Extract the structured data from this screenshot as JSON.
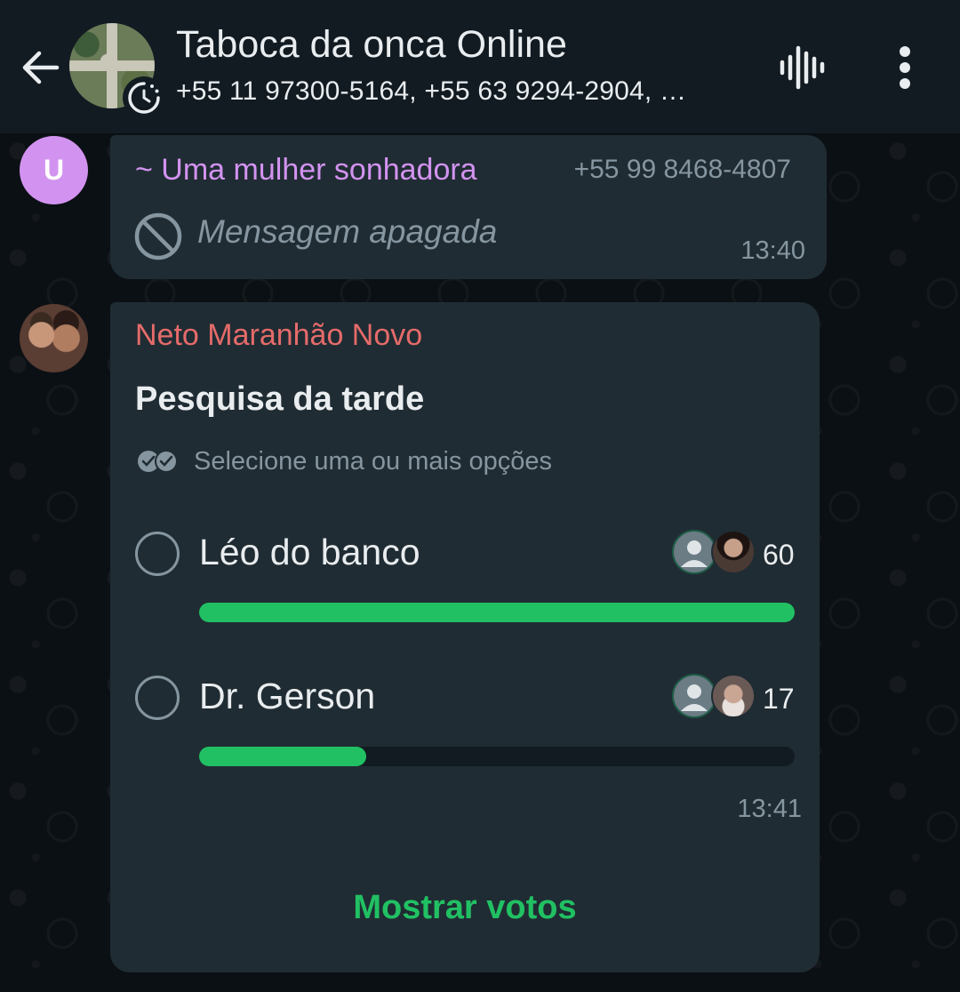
{
  "header": {
    "title": "Taboca da onca Online",
    "subtitle": "+55 11 97300-5164, +55 63 9294-2904, …",
    "icons": [
      "arrow-left-icon",
      "group-avatar",
      "status-ring-icon",
      "voice-waveform-icon",
      "more-vert-icon"
    ]
  },
  "messages": [
    {
      "avatar_letter": "U",
      "avatar_color": "#d293f0",
      "sender": "~ Uma mulher sonhadora",
      "sender_color": "#d293f0",
      "phone": "+55 99 8468-4807",
      "deleted_text": "Mensagem apagada",
      "time": "13:40"
    },
    {
      "sender": "Neto Maranhão Novo",
      "sender_color": "#e56b6a",
      "poll": {
        "question": "Pesquisa da tarde",
        "hint": "Selecione uma ou mais opções",
        "options": [
          {
            "label": "Léo do banco",
            "votes": "60",
            "fraction": 1.0
          },
          {
            "label": "Dr. Gerson",
            "votes": "17",
            "fraction": 0.28
          }
        ],
        "time": "13:41",
        "show_votes_label": "Mostrar votos"
      }
    }
  ],
  "colors": {
    "accent_green": "#21c063",
    "bubble_bg": "#202c33",
    "header_bg": "#121b22",
    "secondary_text": "#8696a0"
  }
}
